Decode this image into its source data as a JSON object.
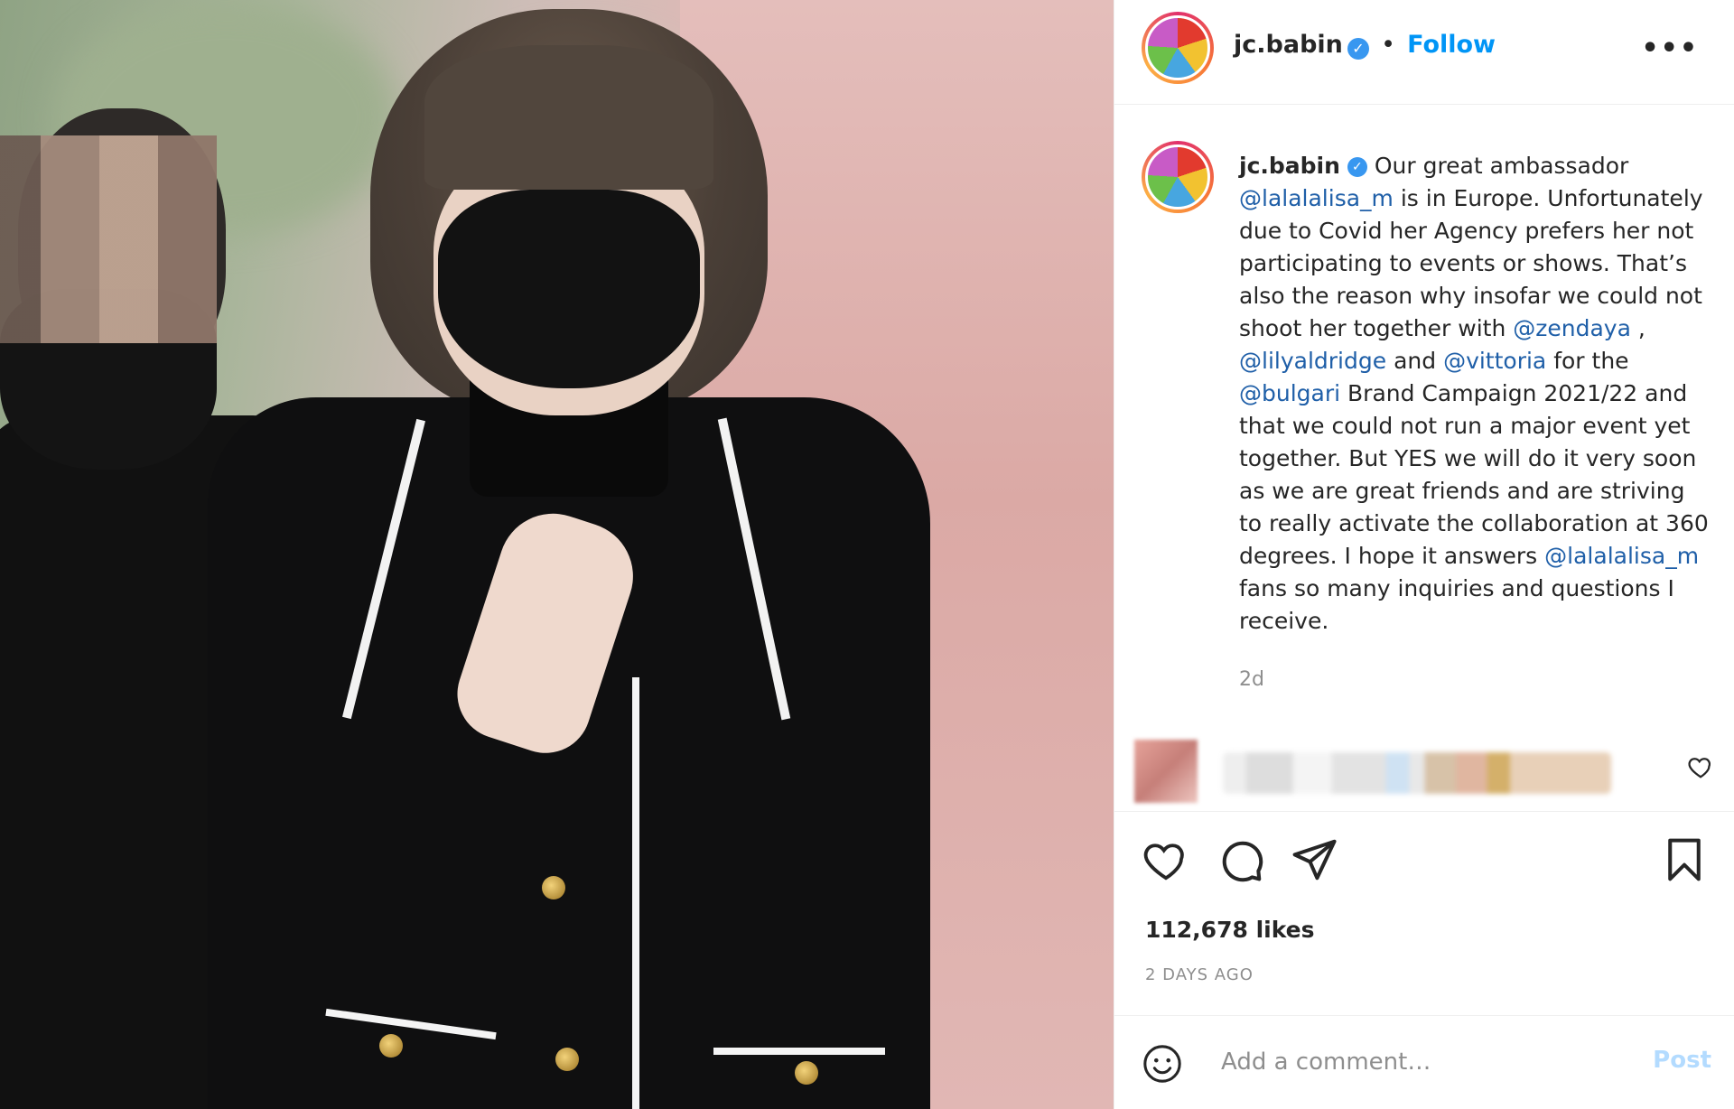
{
  "post": {
    "author": "jc.babin",
    "follow_label": "Follow",
    "separator": "•",
    "more_label": "•••",
    "caption": {
      "username": "jc.babin",
      "parts": [
        {
          "text": "Our great ambassador ",
          "mention": false
        },
        {
          "text": "@lalalalisa_m",
          "mention": true
        },
        {
          "text": " is in Europe. Unfortunately due to Covid her Agency prefers her not participating to events or shows. That’s also the reason why insofar we could not shoot her together with ",
          "mention": false
        },
        {
          "text": "@zendaya",
          "mention": true
        },
        {
          "text": " , ",
          "mention": false
        },
        {
          "text": "@lilyaldridge",
          "mention": true
        },
        {
          "text": " and ",
          "mention": false
        },
        {
          "text": "@vittoria",
          "mention": true
        },
        {
          "text": " for the ",
          "mention": false
        },
        {
          "text": "@bulgari",
          "mention": true
        },
        {
          "text": " Brand Campaign 2021/22 and that we could not run a major event yet together. But YES we will do it very soon as we are great friends and are striving to really activate the collaboration at 360 degrees. I hope it answers ",
          "mention": false
        },
        {
          "text": "@lalalalisa_m",
          "mention": true
        },
        {
          "text": " fans so many inquiries and questions I receive.",
          "mention": false
        }
      ],
      "time": "2d"
    },
    "likes": "112,678 likes",
    "posted": "2 DAYS AGO",
    "comment": {
      "placeholder": "Add a comment…",
      "post_label": "Post"
    }
  },
  "icons": {
    "verified": "verified-badge-icon",
    "like": "heart-icon",
    "comment": "comment-icon",
    "share": "paper-plane-icon",
    "save": "bookmark-icon",
    "emoji": "smiley-icon",
    "comment_like": "small-heart-icon"
  },
  "colors": {
    "link": "#0095f6",
    "mention": "#1f5fa8",
    "muted": "#8e8e8e",
    "post_disabled": "#b3dbff"
  }
}
